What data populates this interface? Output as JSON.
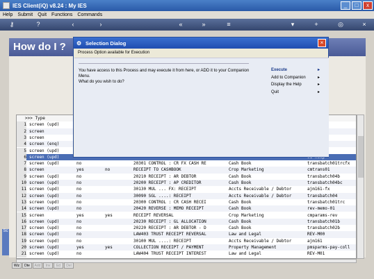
{
  "window": {
    "title": "IES Client(iQ) v8.24 : My IES",
    "min": "_",
    "max": "□",
    "close": "x"
  },
  "menu": [
    "Help",
    "Submit",
    "Quit",
    "Functions",
    "Commands"
  ],
  "toolbar_icons": [
    "key-icon",
    "help-icon",
    "back-icon",
    "forward-icon",
    "rewind-icon",
    "fast-forward-icon",
    "list-icon",
    "chevron-down-icon",
    "add-icon",
    "globe-icon",
    "close-icon"
  ],
  "banner": {
    "text": "How do I ?"
  },
  "dialog": {
    "title": "Selection Dialog",
    "subtitle": "Process Option available for Execution",
    "message_line1": "You have access to this Process and may execute it from here, or ADD it to your Companion Menu.",
    "message_line2": "What do you wish to do?",
    "options": [
      "Execute",
      "Add to Companion",
      "Display the Help",
      "Quit"
    ]
  },
  "grid": {
    "header": ">>> Type",
    "header_right": "y",
    "rows": [
      {
        "num": "1",
        "type": "screen (upd)",
        "a": "",
        "b": "",
        "c": "",
        "d": "",
        "e": "hl9rect"
      },
      {
        "num": "2",
        "type": "screen",
        "a": "",
        "b": "",
        "c": "",
        "d": "",
        "e": ""
      },
      {
        "num": "3",
        "type": "screen",
        "a": "",
        "b": "",
        "c": "",
        "d": "",
        "e": "t"
      },
      {
        "num": "4",
        "type": "screen (enq)",
        "a": "",
        "b": "",
        "c": "",
        "d": "",
        "e": "nq"
      },
      {
        "num": "5",
        "type": "screen (upd)",
        "a": "",
        "b": "",
        "c": "",
        "d": "",
        "e": "01"
      },
      {
        "num": "6",
        "type": "screen (upd)",
        "a": "",
        "b": "",
        "c": "",
        "d": "",
        "e": "01-hosp"
      },
      {
        "num": "7",
        "type": "screen (upd)",
        "a": "no",
        "b": "",
        "c": "20301 CONTROL : CR FX CASH RE",
        "d": "Cash Book",
        "e": "transbatch01trcfx"
      },
      {
        "num": "8",
        "type": "screen",
        "a": "yes",
        "b": "no",
        "c": "RECEIPT TO CASHBOOK",
        "d": "Crop Marketing",
        "e": "cmtrans01"
      },
      {
        "num": "9",
        "type": "screen (upd)",
        "a": "no",
        "b": "",
        "c": "20210 RECEIPT : AR DEBTOR",
        "d": "Cash Book",
        "e": "transbatch04b"
      },
      {
        "num": "10",
        "type": "screen (upd)",
        "a": "no",
        "b": "",
        "c": "20200 RECEIPT : AP CREDITOR",
        "d": "Cash Book",
        "e": "transbatch04bc"
      },
      {
        "num": "11",
        "type": "screen (upd)",
        "a": "no",
        "b": "",
        "c": "30130 MUL ... FX: RECEIPT",
        "d": "Accts Receivable / Debtor",
        "e": "ajm161-fx"
      },
      {
        "num": "12",
        "type": "screen (upd)",
        "a": "no",
        "b": "",
        "c": "30090 SGL ....: RECEIPT",
        "d": "Accts Receivable / Debtor",
        "e": "transbatch04"
      },
      {
        "num": "13",
        "type": "screen (upd)",
        "a": "no",
        "b": "",
        "c": "20300 CONTROL : CR CASH RECEI",
        "d": "Cash Book",
        "e": "transbatch01trc"
      },
      {
        "num": "14",
        "type": "screen (upd)",
        "a": "no",
        "b": "",
        "c": "20420 REVERSE : MEMO RECEIPT",
        "d": "Cash Book",
        "e": "rev-memo-01"
      },
      {
        "num": "15",
        "type": "screen",
        "a": "yes",
        "b": "yes",
        "c": "RECEIPT REVERSAL",
        "d": "Crop Marketing",
        "e": "cmparams-rev"
      },
      {
        "num": "16",
        "type": "screen (upd)",
        "a": "no",
        "b": "",
        "c": "20230 RECEIPT : GL ALLOCATION",
        "d": "Cash Book",
        "e": "transbatch01b"
      },
      {
        "num": "17",
        "type": "screen (upd)",
        "a": "no",
        "b": "",
        "c": "20220 RECEIPT : AR DEBTOR - D",
        "d": "Cash Book",
        "e": "transbatch02b"
      },
      {
        "num": "18",
        "type": "screen (upd)",
        "a": "no",
        "b": "",
        "c": "LAW403 TRUST RECEIPT REVERSAL",
        "d": "Law and Legal",
        "e": "REV-M00"
      },
      {
        "num": "19",
        "type": "screen (upd)",
        "a": "no",
        "b": "",
        "c": "30100 MUL ....: RECEIPT",
        "d": "Accts Receivable / Debtor",
        "e": "ajm161"
      },
      {
        "num": "20",
        "type": "screen (upd)",
        "a": "yes",
        "b": "yes",
        "c": "COLLECTION RECEIPT / PAYMENT",
        "d": "Property Management",
        "e": "pmsparms-pay-coll"
      },
      {
        "num": "21",
        "type": "screen (upd)",
        "a": "no",
        "b": "",
        "c": "LAW404 TRUST RECEIPT INTEREST",
        "d": "Law and Legal",
        "e": "REV-M01"
      }
    ]
  },
  "bottom_tabs": [
    "Wiz",
    "Dte",
    "Add",
    "Inv",
    "Ed",
    "Del"
  ],
  "left_tab": "Sc"
}
